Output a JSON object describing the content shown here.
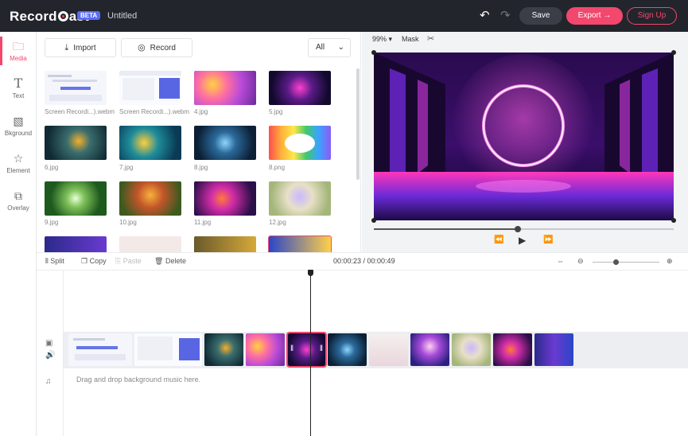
{
  "app": {
    "logo_text": "Record",
    "logo_suffix": "ast",
    "beta": "BETA",
    "doc_title": "Untitled"
  },
  "header": {
    "save": "Save",
    "export": "Export",
    "signup": "Sign Up"
  },
  "nav": [
    {
      "label": "Media",
      "icon": "media-icon"
    },
    {
      "label": "Text",
      "icon": "text-icon"
    },
    {
      "label": "Bkground",
      "icon": "background-icon"
    },
    {
      "label": "Element",
      "icon": "element-icon"
    },
    {
      "label": "Overlay",
      "icon": "overlay-icon"
    }
  ],
  "media": {
    "import": "Import",
    "record": "Record",
    "filter": "All",
    "items": [
      {
        "label": "Screen Recordi...).webm"
      },
      {
        "label": "Screen Recordi...).webm"
      },
      {
        "label": "4.jpg"
      },
      {
        "label": "5.jpg"
      },
      {
        "label": "6.jpg"
      },
      {
        "label": "7.jpg"
      },
      {
        "label": "8.jpg"
      },
      {
        "label": "8.png"
      },
      {
        "label": "9.jpg"
      },
      {
        "label": "10.jpg"
      },
      {
        "label": "11.jpg"
      },
      {
        "label": "12.jpg"
      }
    ]
  },
  "preview": {
    "zoom": "99%",
    "mask": "Mask",
    "progress": 0.48
  },
  "timeline": {
    "split": "Split",
    "copy": "Copy",
    "paste": "Paste",
    "delete": "Delete",
    "timecode": "00:00:23 / 00:00:49",
    "zoom_level": 0.35,
    "music_hint": "Drag and drop background music here."
  },
  "colors": {
    "accent": "#f3476d",
    "topbar": "#23252c"
  }
}
